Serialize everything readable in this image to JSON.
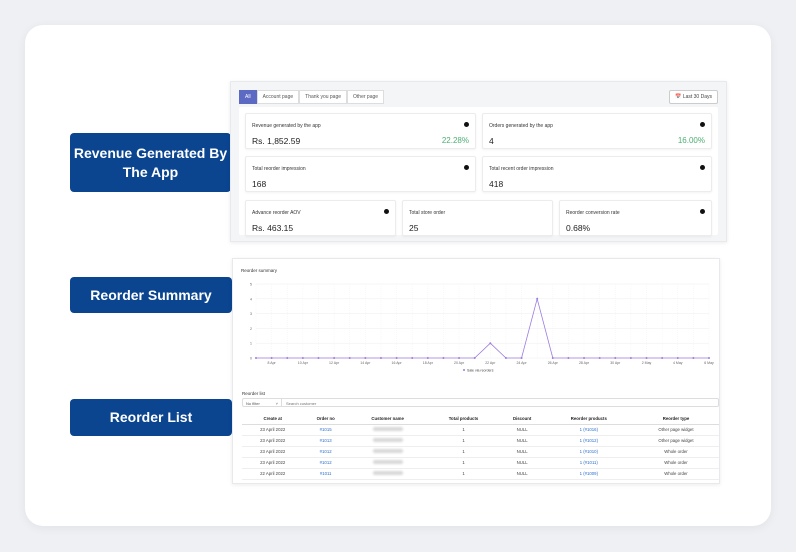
{
  "callouts": [
    "Revenue Generated By The App",
    "Reorder Summary",
    "Reorder List"
  ],
  "tabs": [
    "All",
    "Account page",
    "Thank you page",
    "Other page"
  ],
  "date_range": "Last 30 Days",
  "cards": [
    {
      "label": "Revenue generated by the app",
      "value": "Rs. 1,852.59",
      "change": "22.28%"
    },
    {
      "label": "Orders generated by the app",
      "value": "4",
      "change": "16.00%"
    },
    {
      "label": "Total reorder impression",
      "value": "168"
    },
    {
      "label": "Total recent order impression",
      "value": "418"
    },
    {
      "label": "Advance reorder AOV",
      "value": "Rs. 463.15"
    },
    {
      "label": "Total store order",
      "value": "25"
    },
    {
      "label": "Reorder conversion rate",
      "value": "0.68%"
    }
  ],
  "colors": {
    "accent": "#5c6ac4",
    "callout": "#0b4590",
    "positive": "#4caf72",
    "series": "#9b7be0"
  },
  "chart_data": {
    "type": "line",
    "title": "Reorder summary",
    "ylim": [
      0,
      5
    ],
    "yticks": [
      0,
      1,
      2,
      3,
      4,
      5
    ],
    "grid": true,
    "legend": "bottom",
    "x": [
      "7 Apr",
      "8 Apr",
      "9 Apr",
      "10 Apr",
      "11 Apr",
      "12 Apr",
      "13 Apr",
      "14 Apr",
      "15 Apr",
      "16 Apr",
      "17 Apr",
      "18 Apr",
      "19 Apr",
      "20 Apr",
      "21 Apr",
      "22 Apr",
      "23 Apr",
      "24 Apr",
      "25 Apr",
      "26 Apr",
      "27 Apr",
      "28 Apr",
      "29 Apr",
      "30 Apr",
      "1 May",
      "2 May",
      "3 May",
      "4 May",
      "5 May",
      "6 May"
    ],
    "xticklabels": [
      "8 Apr",
      "10 Apr",
      "12 Apr",
      "14 Apr",
      "16 Apr",
      "18 Apr",
      "20 Apr",
      "22 Apr",
      "24 Apr",
      "26 Apr",
      "28 Apr",
      "30 Apr",
      "2 May",
      "4 May",
      "6 May"
    ],
    "series": [
      {
        "name": "Sale via reorders",
        "values": [
          0,
          0,
          0,
          0,
          0,
          0,
          0,
          0,
          0,
          0,
          0,
          0,
          0,
          0,
          0,
          1,
          0,
          0,
          4,
          0,
          0,
          0,
          0,
          0,
          0,
          0,
          0,
          0,
          0,
          0
        ]
      }
    ]
  },
  "list": {
    "title": "Reorder list",
    "filter": "No filter",
    "search_placeholder": "Search customer",
    "columns": [
      "Create at",
      "Order no",
      "Customer name",
      "Total products",
      "Discount",
      "Reorder products",
      "Reorder type"
    ],
    "rows": [
      [
        "23 April 2022",
        "#1015",
        "",
        "1",
        "NULL",
        "1 (#1016)",
        "Other page widget"
      ],
      [
        "23 April 2022",
        "#1013",
        "",
        "1",
        "NULL",
        "1 (#1012)",
        "Other page widget"
      ],
      [
        "23 April 2022",
        "#1012",
        "",
        "1",
        "NULL",
        "1 (#1010)",
        "Whole order"
      ],
      [
        "23 April 2022",
        "#1012",
        "",
        "1",
        "NULL",
        "1 (#1011)",
        "Whole order"
      ],
      [
        "22 April 2022",
        "#1011",
        "",
        "1",
        "NULL",
        "1 (#1009)",
        "Whole order"
      ]
    ]
  }
}
